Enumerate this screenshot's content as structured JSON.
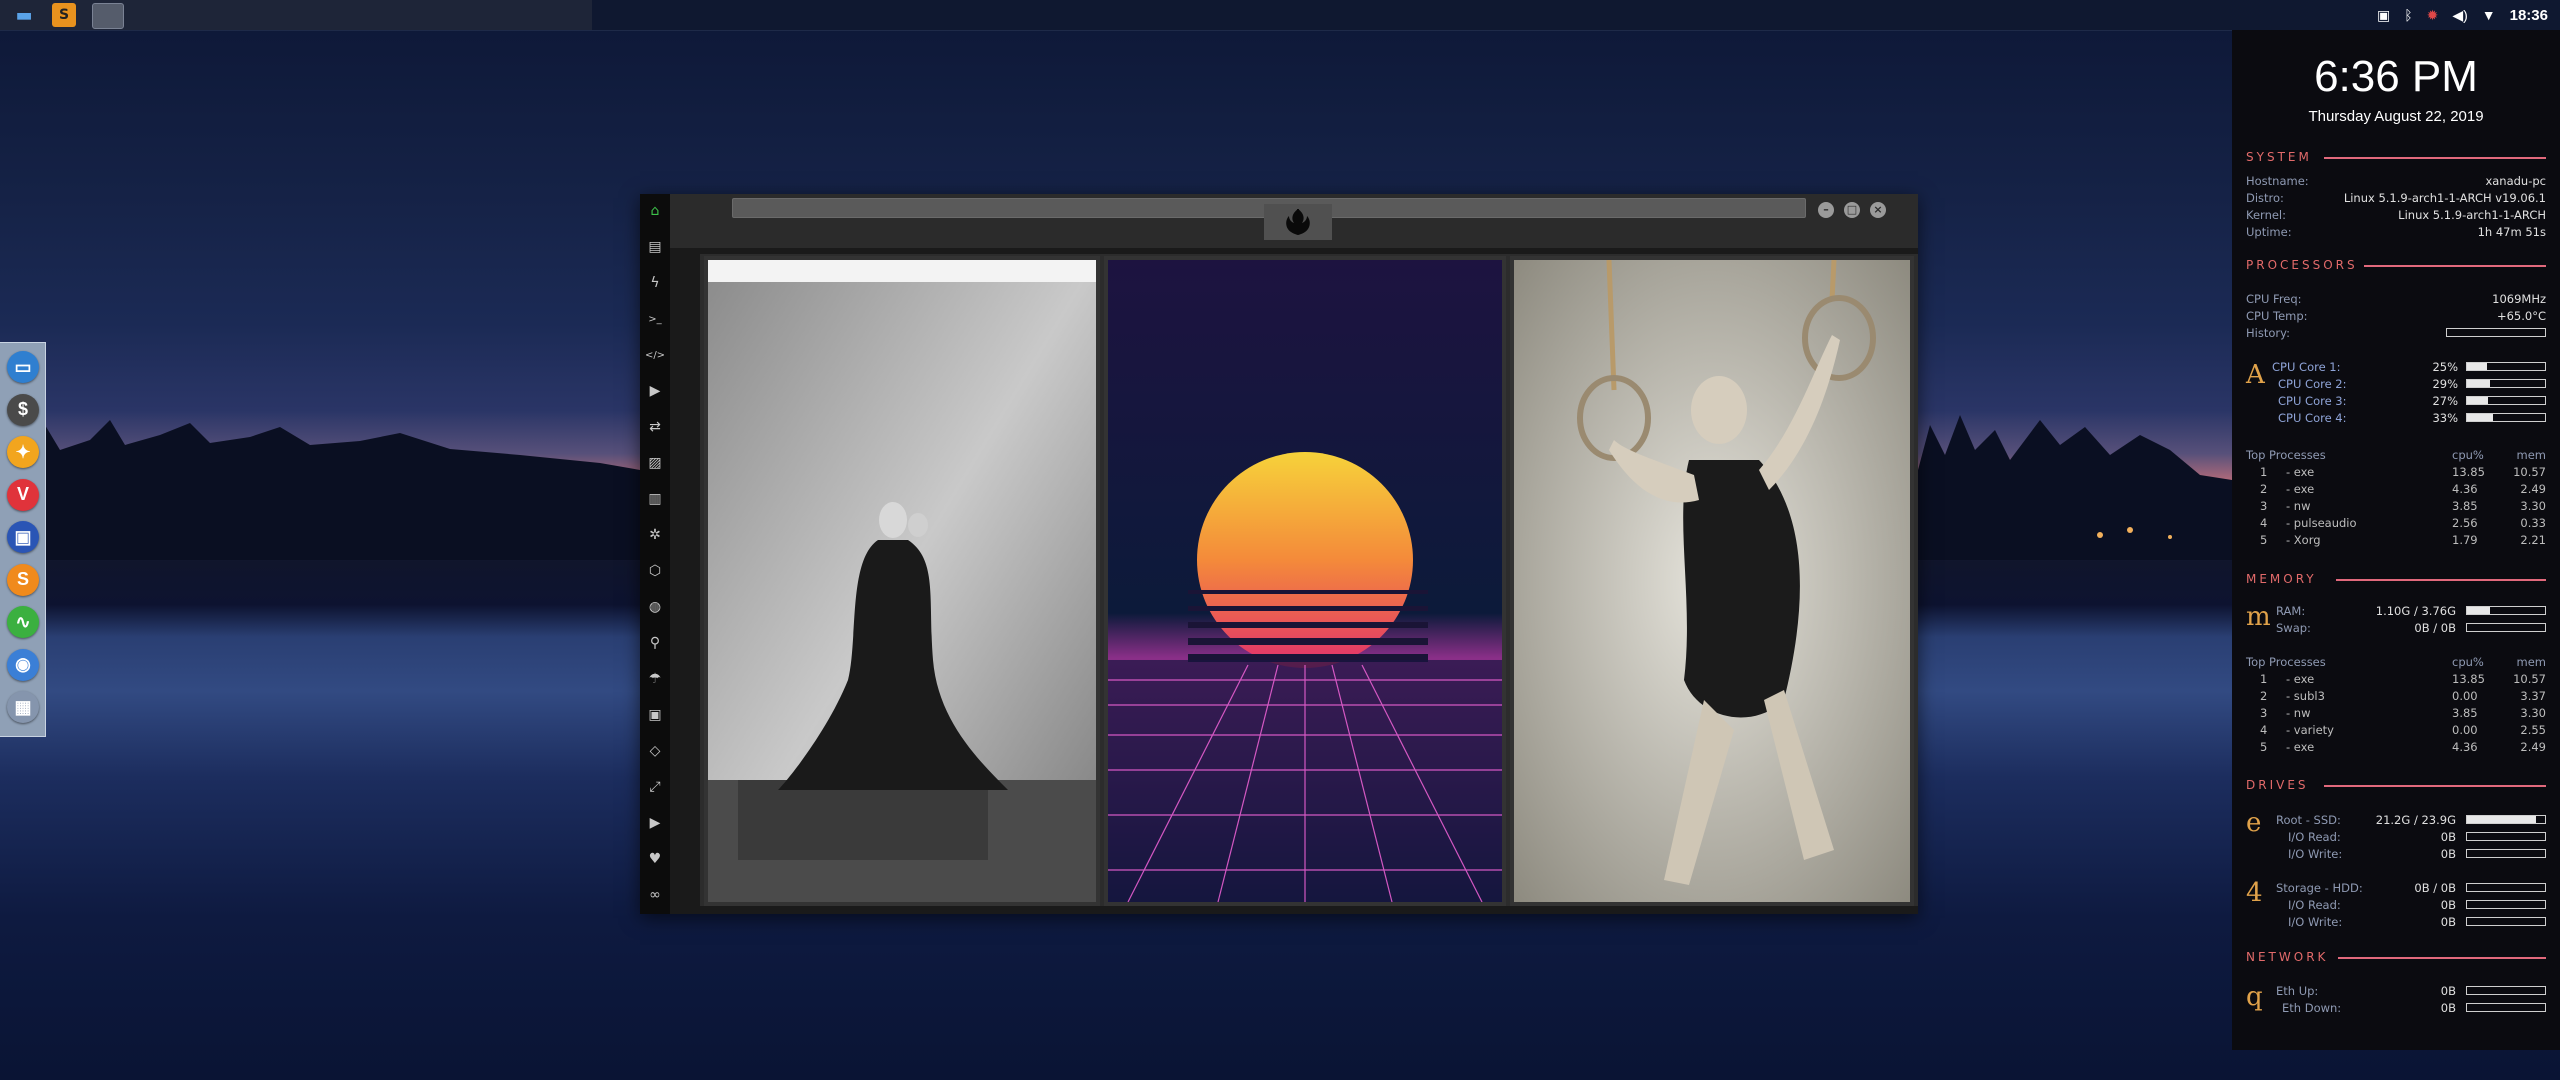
{
  "top_panel": {
    "clock": "18:36",
    "taskbar_icons": [
      "folder-icon",
      "sublime-icon",
      "app-icon"
    ],
    "tray_icons": [
      "screenshot-icon",
      "bluetooth-icon",
      "update-icon",
      "volume-icon",
      "wifi-icon"
    ]
  },
  "dock": {
    "items": [
      {
        "name": "files-icon",
        "glyph": "▭",
        "color": "#2f7fd0"
      },
      {
        "name": "terminal-icon",
        "glyph": "$",
        "color": "#4a4a4a"
      },
      {
        "name": "lan-icon",
        "glyph": "✦",
        "color": "#f2a51e"
      },
      {
        "name": "vivaldi-icon",
        "glyph": "V",
        "color": "#e0333b"
      },
      {
        "name": "screen-icon",
        "glyph": "▣",
        "color": "#2a55b5"
      },
      {
        "name": "sublime-icon",
        "glyph": "S",
        "color": "#f08a1c"
      },
      {
        "name": "system-monitor-icon",
        "glyph": "∿",
        "color": "#3bb040"
      },
      {
        "name": "chrome-icon",
        "glyph": "◉",
        "color": "#3b7fd6"
      },
      {
        "name": "grid-icon",
        "glyph": "▦",
        "color": "#8595ad"
      }
    ]
  },
  "app": {
    "sidebar_icons": [
      {
        "name": "home-icon",
        "glyph": "⌂",
        "active": true
      },
      {
        "name": "document-icon",
        "glyph": "▤"
      },
      {
        "name": "bolt-icon",
        "glyph": "ϟ"
      },
      {
        "name": "terminal-icon",
        "glyph": ">_"
      },
      {
        "name": "code-icon",
        "glyph": "</>"
      },
      {
        "name": "play-icon",
        "glyph": "▶"
      },
      {
        "name": "translate-icon",
        "glyph": "⇄"
      },
      {
        "name": "image-icon",
        "glyph": "▨"
      },
      {
        "name": "news-icon",
        "glyph": "▥"
      },
      {
        "name": "atom-icon",
        "glyph": "✲"
      },
      {
        "name": "hexagon-icon",
        "glyph": "⬡"
      },
      {
        "name": "globe-icon",
        "glyph": "◍"
      },
      {
        "name": "search-icon",
        "glyph": "⚲"
      },
      {
        "name": "umbrella-icon",
        "glyph": "☂"
      },
      {
        "name": "contact-icon",
        "glyph": "▣"
      },
      {
        "name": "diamond-icon",
        "glyph": "◇"
      },
      {
        "name": "expand-icon",
        "glyph": "⤢"
      },
      {
        "name": "youtube-icon",
        "glyph": "▶"
      },
      {
        "name": "heart-icon",
        "glyph": "♥"
      },
      {
        "name": "infinity-icon",
        "glyph": "∞"
      }
    ],
    "window_buttons": [
      "minimize-button",
      "maximize-button",
      "close-button"
    ],
    "logo": "rebel-alliance-logo"
  },
  "conky": {
    "time": "6:36 PM",
    "date": "Thursday August 22, 2019",
    "system": {
      "heading": "SYSTEM",
      "rows": [
        {
          "label": "Hostname:",
          "value": "xanadu-pc"
        },
        {
          "label": "Distro:",
          "value": "Linux 5.1.9-arch1-1-ARCH v19.06.1"
        },
        {
          "label": "Kernel:",
          "value": "Linux 5.1.9-arch1-1-ARCH"
        },
        {
          "label": "Uptime:",
          "value": "1h 47m 51s"
        }
      ]
    },
    "processors": {
      "heading": "PROCESSORS",
      "freq_label": "CPU Freq:",
      "freq": "1069MHz",
      "temp_label": "CPU Temp:",
      "temp": "+65.0°C",
      "history_label": "History:",
      "letter": "A",
      "cores": [
        {
          "label": "CPU Core 1:",
          "value": "25%",
          "fraction": 0.25
        },
        {
          "label": "CPU Core 2:",
          "value": "29%",
          "fraction": 0.29
        },
        {
          "label": "CPU Core 3:",
          "value": "27%",
          "fraction": 0.27
        },
        {
          "label": "CPU Core 4:",
          "value": "33%",
          "fraction": 0.33
        }
      ],
      "top_header": {
        "title": "Top Processes",
        "c1": "cpu%",
        "c2": "mem"
      },
      "top": [
        {
          "rank": "1",
          "name": "exe",
          "cpu": "13.85",
          "mem": "10.57"
        },
        {
          "rank": "2",
          "name": "exe",
          "cpu": "4.36",
          "mem": "2.49"
        },
        {
          "rank": "3",
          "name": "nw",
          "cpu": "3.85",
          "mem": "3.30"
        },
        {
          "rank": "4",
          "name": "pulseaudio",
          "cpu": "2.56",
          "mem": "0.33"
        },
        {
          "rank": "5",
          "name": "Xorg",
          "cpu": "1.79",
          "mem": "2.21"
        }
      ]
    },
    "memory": {
      "heading": "MEMORY",
      "letter": "m",
      "ram_label": "RAM:",
      "ram": "1.10G / 3.76G",
      "ram_fraction": 0.29,
      "swap_label": "Swap:",
      "swap": "0B / 0B",
      "swap_fraction": 0,
      "top_header": {
        "title": "Top Processes",
        "c1": "cpu%",
        "c2": "mem"
      },
      "top": [
        {
          "rank": "1",
          "name": "exe",
          "cpu": "13.85",
          "mem": "10.57"
        },
        {
          "rank": "2",
          "name": "subl3",
          "cpu": "0.00",
          "mem": "3.37"
        },
        {
          "rank": "3",
          "name": "nw",
          "cpu": "3.85",
          "mem": "3.30"
        },
        {
          "rank": "4",
          "name": "variety",
          "cpu": "0.00",
          "mem": "2.55"
        },
        {
          "rank": "5",
          "name": "exe",
          "cpu": "4.36",
          "mem": "2.49"
        }
      ]
    },
    "drives": {
      "heading": "DRIVES",
      "root_letter": "e",
      "root_label": "Root - SSD:",
      "root": "21.2G / 23.9G",
      "root_fraction": 0.89,
      "root_read_label": "I/O Read:",
      "root_read": "0B",
      "root_write_label": "I/O Write:",
      "root_write": "0B",
      "storage_letter": "4",
      "storage_label": "Storage - HDD:",
      "storage": "0B / 0B",
      "storage_read_label": "I/O Read:",
      "storage_read": "0B",
      "storage_write_label": "I/O Write:",
      "storage_write": "0B"
    },
    "network": {
      "heading": "NETWORK",
      "letter": "q",
      "up_label": "Eth Up:",
      "up": "0B",
      "down_label": "Eth Down:",
      "down": "0B"
    }
  }
}
